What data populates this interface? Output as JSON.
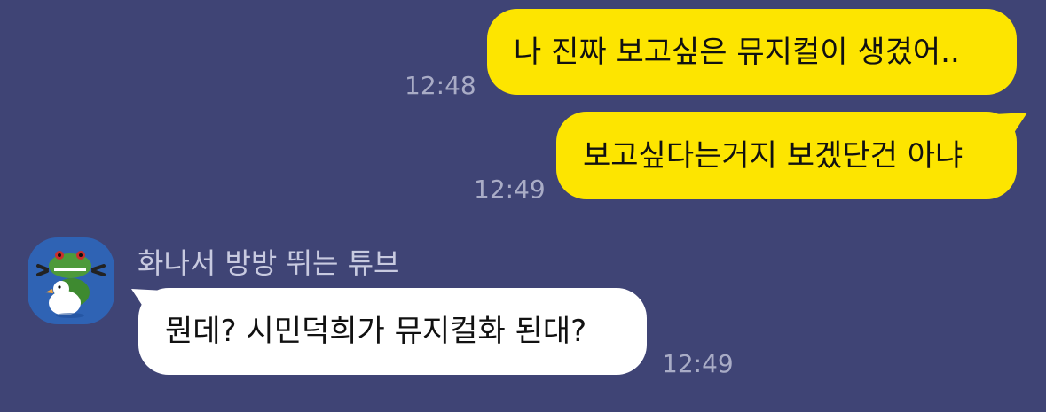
{
  "messages": [
    {
      "direction": "outgoing",
      "text": "나 진짜 보고싶은 뮤지컬이 생겼어..",
      "time": "12:48"
    },
    {
      "direction": "outgoing",
      "text": "보고싶다는거지 보겠단건 아냐",
      "time": "12:49"
    },
    {
      "direction": "incoming",
      "sender": "화나서 방방 뛰는 튜브",
      "text": "뭔데? 시민덕희가 뮤지컬화 된대?",
      "time": "12:49"
    }
  ],
  "colors": {
    "background": "#3f4475",
    "outgoing_bubble": "#fde500",
    "incoming_bubble": "#ffffff",
    "timestamp": "#a9acc6",
    "sender_name": "#c8cae0",
    "avatar_bg": "#2f63b4"
  },
  "icons": {
    "avatar": "tube-duck-character-avatar"
  }
}
